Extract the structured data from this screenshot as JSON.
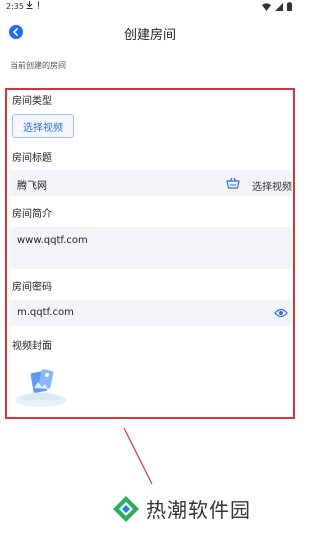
{
  "status_bar": {
    "time": "2:35",
    "left_icons": [
      "download-icon",
      "alert-icon"
    ],
    "right_icons": [
      "wifi-icon",
      "signal-icon",
      "battery-icon"
    ]
  },
  "header": {
    "title": "创建房间",
    "back_icon": "chevron-left-icon"
  },
  "section_hint": "当前创建的房间",
  "form": {
    "room_type": {
      "label": "房间类型",
      "button": "选择视频"
    },
    "room_title": {
      "label": "房间标题",
      "value": "腾飞网",
      "action_icon": "basket-icon",
      "action_label": "选择视频"
    },
    "room_intro": {
      "label": "房间简介",
      "value": "www.qqtf.com"
    },
    "room_password": {
      "label": "房间密码",
      "value": "m.qqtf.com",
      "toggle_icon": "eye-icon"
    },
    "video_cover": {
      "label": "视频封面",
      "image_icon": "image-placeholder-icon"
    }
  },
  "watermark": {
    "text": "热潮软件园",
    "logo_icon": "diamond-logo-icon"
  },
  "colors": {
    "accent": "#1e6df6",
    "highlight_border": "#d9333a",
    "input_bg": "#f3f4f7"
  }
}
